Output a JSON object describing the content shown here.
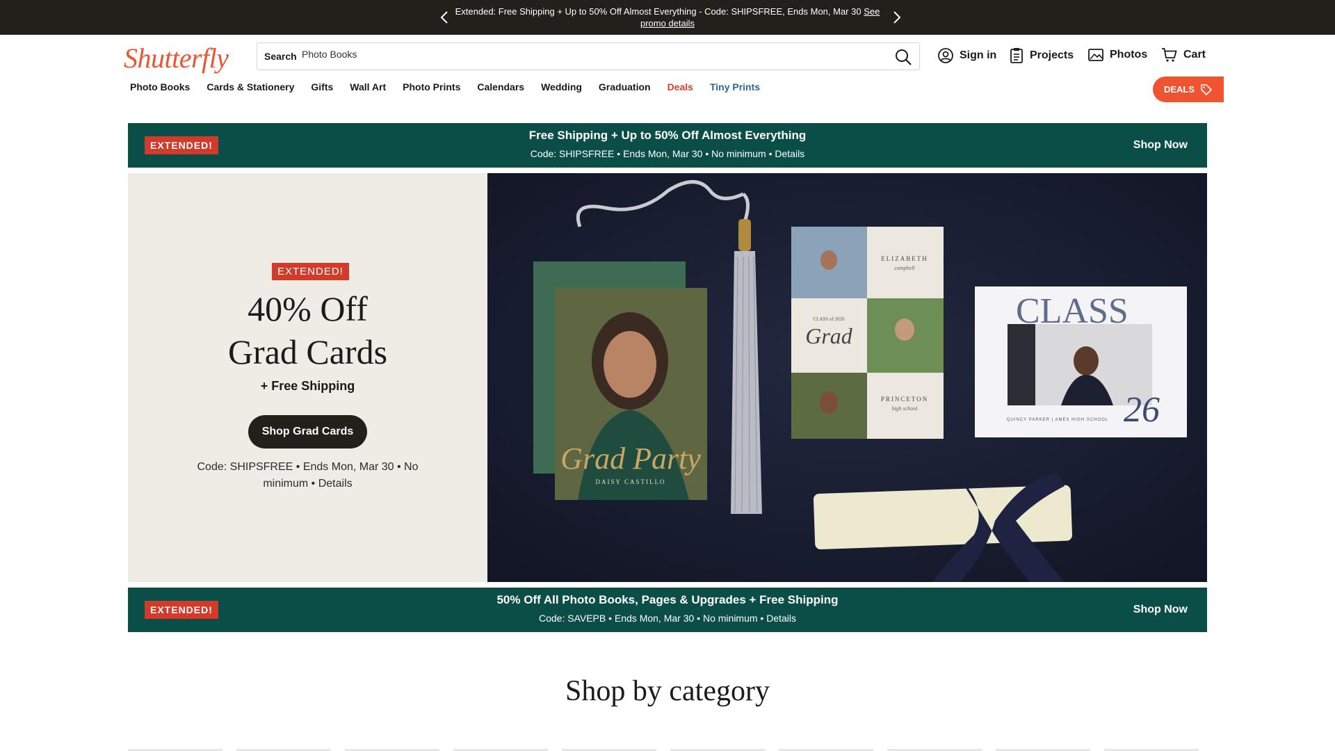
{
  "topbar": {
    "promo_text": "Extended: Free Shipping + Up to 50% Off Almost Everything - Code: SHIPSFREE, Ends Mon, Mar 30",
    "promo_link": "See promo details"
  },
  "header": {
    "logo": "Shutterfly",
    "search_label": "Search",
    "search_value": "Photo Books",
    "sign_in": "Sign in",
    "projects": "Projects",
    "photos": "Photos",
    "cart": "Cart"
  },
  "nav": {
    "items": [
      "Photo Books",
      "Cards & Stationery",
      "Gifts",
      "Wall Art",
      "Photo Prints",
      "Calendars",
      "Wedding",
      "Graduation",
      "Deals",
      "Tiny Prints"
    ],
    "deals_button": "DEALS"
  },
  "band1": {
    "badge": "EXTENDED!",
    "title": "Free Shipping + Up to 50% Off Almost Everything",
    "subtitle": "Code: SHIPSFREE  •  Ends Mon, Mar 30  •  No minimum  •  Details",
    "shop": "Shop Now"
  },
  "hero": {
    "badge": "EXTENDED!",
    "headline_1": "40% Off",
    "headline_2": "Grad Cards",
    "free_shipping": "+ Free Shipping",
    "cta": "Shop Grad Cards",
    "terms": "Code: SHIPSFREE  •  Ends Mon, Mar 30  •  No minimum  •  Details",
    "card_text_1": "Grad Party",
    "card_text_2": "DAISY CASTILLO",
    "card_text_3": "ELIZABETH",
    "card_text_4": "campbell",
    "card_text_5": "CLASS of 2026",
    "card_text_6": "Grad",
    "card_text_7": "PRINCETON",
    "card_text_8": "high school",
    "card_text_9": "CLASS",
    "card_text_10": "26",
    "card_text_11": "QUINCY PARKER | AMES HIGH SCHOOL"
  },
  "band2": {
    "badge": "EXTENDED!",
    "title": "50% Off All Photo Books, Pages & Upgrades + Free Shipping",
    "subtitle": "Code: SAVEPB  •  Ends Mon, Mar 30  •  No minimum  •  Details",
    "shop": "Shop Now"
  },
  "category": {
    "title": "Shop by category"
  },
  "colors": {
    "brand": "#f0532f",
    "band": "#0b4e48",
    "badge": "#d23a2a",
    "topbar": "#231f1b",
    "hero_bg": "#efebe5"
  }
}
